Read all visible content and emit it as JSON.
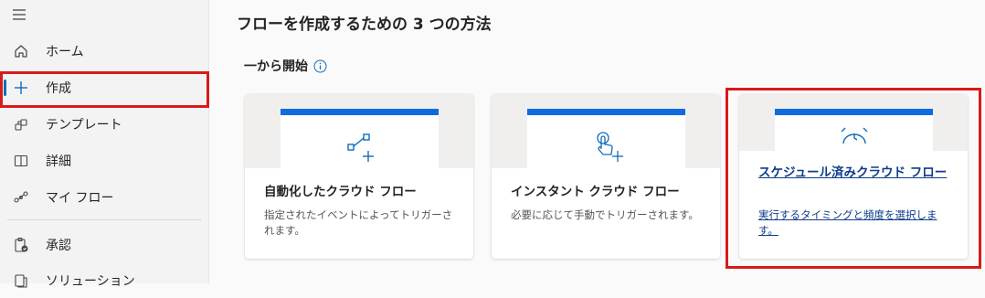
{
  "sidebar": {
    "items": [
      {
        "label": "ホーム"
      },
      {
        "label": "作成"
      },
      {
        "label": "テンプレート"
      },
      {
        "label": "詳細"
      },
      {
        "label": "マイ フロー"
      },
      {
        "label": "承認"
      },
      {
        "label": "ソリューション"
      }
    ]
  },
  "main": {
    "title": "フローを作成するための 3 つの方法",
    "section_title": "一から開始",
    "cards": [
      {
        "title": "自動化したクラウド フロー",
        "description": "指定されたイベントによってトリガーされます。"
      },
      {
        "title": "インスタント クラウド フロー",
        "description": "必要に応じて手動でトリガーされます。"
      },
      {
        "title": "スケジュール済みクラウド フロー",
        "description": "実行するタイミングと頻度を選択します。"
      }
    ]
  },
  "colors": {
    "accent": "#0f6cbd",
    "highlight": "#d91a1a",
    "card_bar": "#0f6cde"
  }
}
